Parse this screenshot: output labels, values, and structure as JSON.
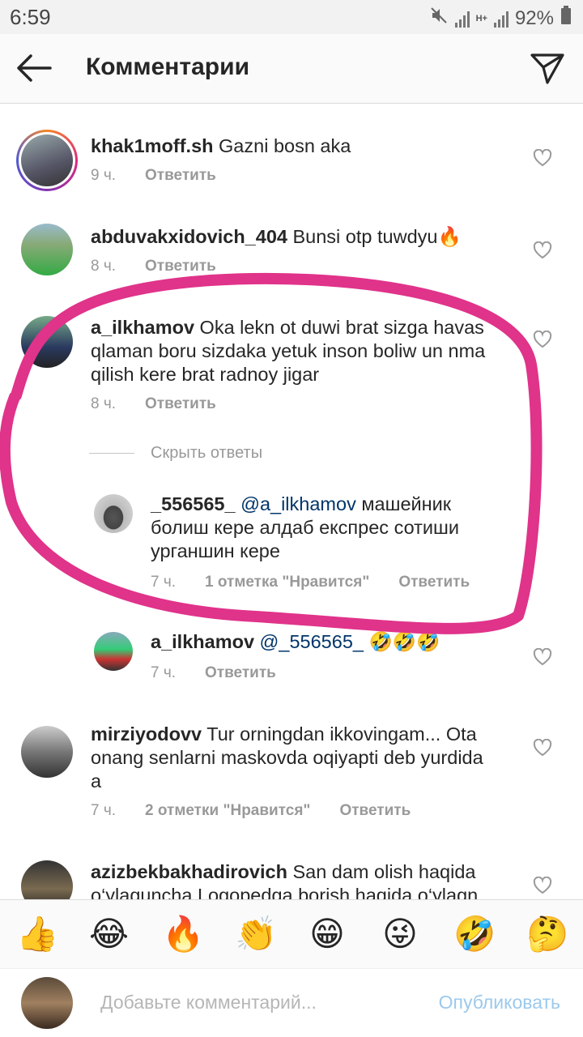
{
  "status_bar": {
    "time": "6:59",
    "battery": "92%",
    "network": "H+"
  },
  "header": {
    "title": "Комментарии",
    "back_icon": "back-arrow-icon",
    "send_icon": "direct-send-icon"
  },
  "comments": [
    {
      "username": "khak1moff.sh",
      "text": "Gazni bosn aka",
      "time": "9 ч.",
      "likes": "",
      "reply": "Ответить"
    },
    {
      "username": "abduvakxidovich_404",
      "text": "Bunsi otp tuwdyu🔥",
      "time": "8 ч.",
      "likes": "",
      "reply": "Ответить"
    },
    {
      "username": "a_ilkhamov",
      "text": "Oka lekn ot duwi brat sizga havas",
      "text2": "qlaman boru sizdaka yetuk inson boliw un nma",
      "text3": "qilish kere brat radnoy jigar",
      "time": "8 ч.",
      "likes": "",
      "reply": "Ответить"
    },
    {
      "username": "mirziyodovv",
      "text": "Tur orningdan ikkovingam... Ota",
      "text2": "onang senlarni maskovda oqiyapti deb yurdida",
      "text3": "a",
      "time": "7 ч.",
      "likes": "2 отметки \"Нравится\"",
      "reply": "Ответить"
    },
    {
      "username": "azizbekbakhadirovich",
      "text": "San  dam olish haqida",
      "text2": "o‘ylaguncha Logopedga borish haqida o‘ylagn"
    }
  ],
  "hide_replies": "Скрыть ответы",
  "replies": [
    {
      "username": "_556565_",
      "mention": "@a_ilkhamov",
      "text": "машейник",
      "text2": "болиш кере алдаб експрес сотиши",
      "text3": "урганшин кере",
      "time": "7 ч.",
      "likes": "1 отметка \"Нравится\"",
      "reply": "Ответить"
    },
    {
      "username": "a_ilkhamov",
      "mention": "@_556565_",
      "text": "🤣🤣🤣",
      "time": "7 ч.",
      "reply": "Ответить"
    }
  ],
  "emoji_bar": [
    "👍",
    "😂",
    "🔥",
    "👏",
    "😁",
    "😜",
    "🤣",
    "🤔"
  ],
  "input": {
    "placeholder": "Добавьте комментарий...",
    "post_label": "Опубликовать"
  },
  "colors": {
    "accent": "#3897f0",
    "marker": "#e0338a",
    "mention": "#003569"
  }
}
